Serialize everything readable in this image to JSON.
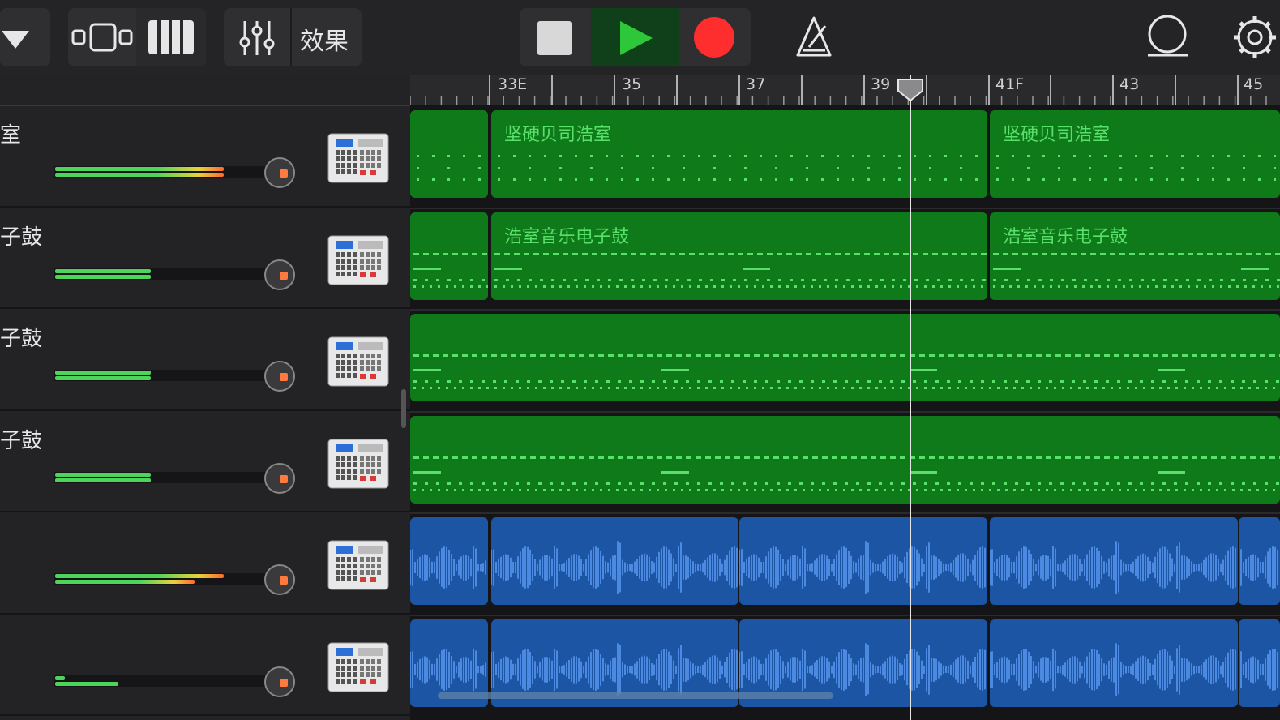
{
  "toolbar": {
    "effects_label": "效果",
    "accent_play": "#2fc73a",
    "accent_record": "#ff2e2e"
  },
  "timeline": {
    "markers": [
      "33E",
      "35",
      "37",
      "39",
      "41F",
      "43",
      "45"
    ]
  },
  "tracks": [
    {
      "name": "室"
    },
    {
      "name": "子鼓"
    },
    {
      "name": "子鼓"
    },
    {
      "name": "子鼓"
    },
    {
      "name": ""
    },
    {
      "name": ""
    }
  ],
  "regions": {
    "track1_left": "坚硬贝司浩室",
    "track1_right": "坚硬贝司浩室",
    "track2_left": "浩室音乐电子鼓",
    "track2_right": "浩室音乐电子鼓"
  },
  "icons": [
    "dropdown-icon",
    "tracks-view-icon",
    "keyboard-icon",
    "mixer-icon",
    "stop-icon",
    "play-icon",
    "record-icon",
    "metronome-icon",
    "loop-browser-icon",
    "settings-icon",
    "drum-machine-icon"
  ]
}
